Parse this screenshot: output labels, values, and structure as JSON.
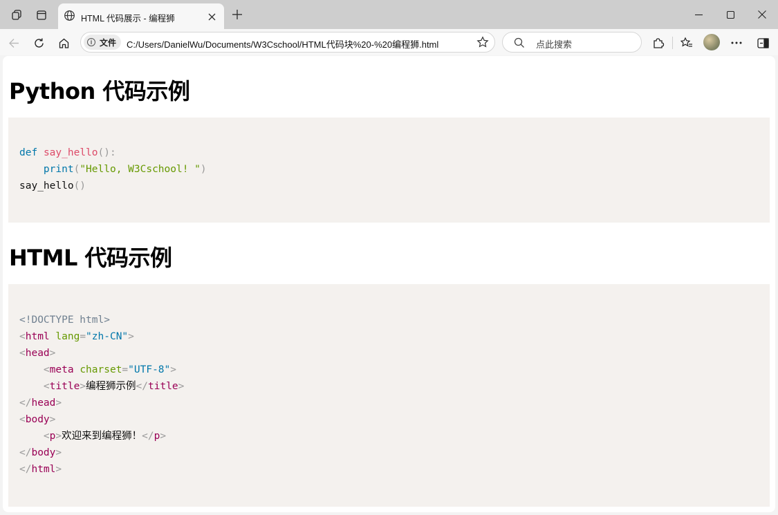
{
  "browser": {
    "tab_title": "HTML 代码展示 - 编程狮",
    "address_label": "文件",
    "url": "C:/Users/DanielWu/Documents/W3Cschool/HTML代码块%20-%20编程狮.html",
    "search_placeholder": "点此搜索",
    "new_tab": "+"
  },
  "page": {
    "section1": {
      "heading": "Python 代码示例",
      "code": {
        "def": "def",
        "fname": "say_hello",
        "paren_colon": "():",
        "indent": "    ",
        "print": "print",
        "open": "(",
        "str": "\"Hello, W3Cschool! \"",
        "close": ")",
        "call": "say_hello",
        "call_paren": "()"
      }
    },
    "section2": {
      "heading": "HTML 代码示例",
      "code": {
        "doctype": "<!DOCTYPE html>",
        "lt": "<",
        "gt": ">",
        "lts": "</",
        "eq": "=",
        "html": "html",
        "head": "head",
        "meta": "meta",
        "title": "title",
        "body": "body",
        "p": "p",
        "lang_attr": "lang",
        "lang_val": "\"zh-CN\"",
        "charset_attr": "charset",
        "charset_val": "\"UTF-8\"",
        "title_text": "编程狮示例",
        "p_text": "欢迎来到编程狮！",
        "indent": "    "
      }
    }
  }
}
